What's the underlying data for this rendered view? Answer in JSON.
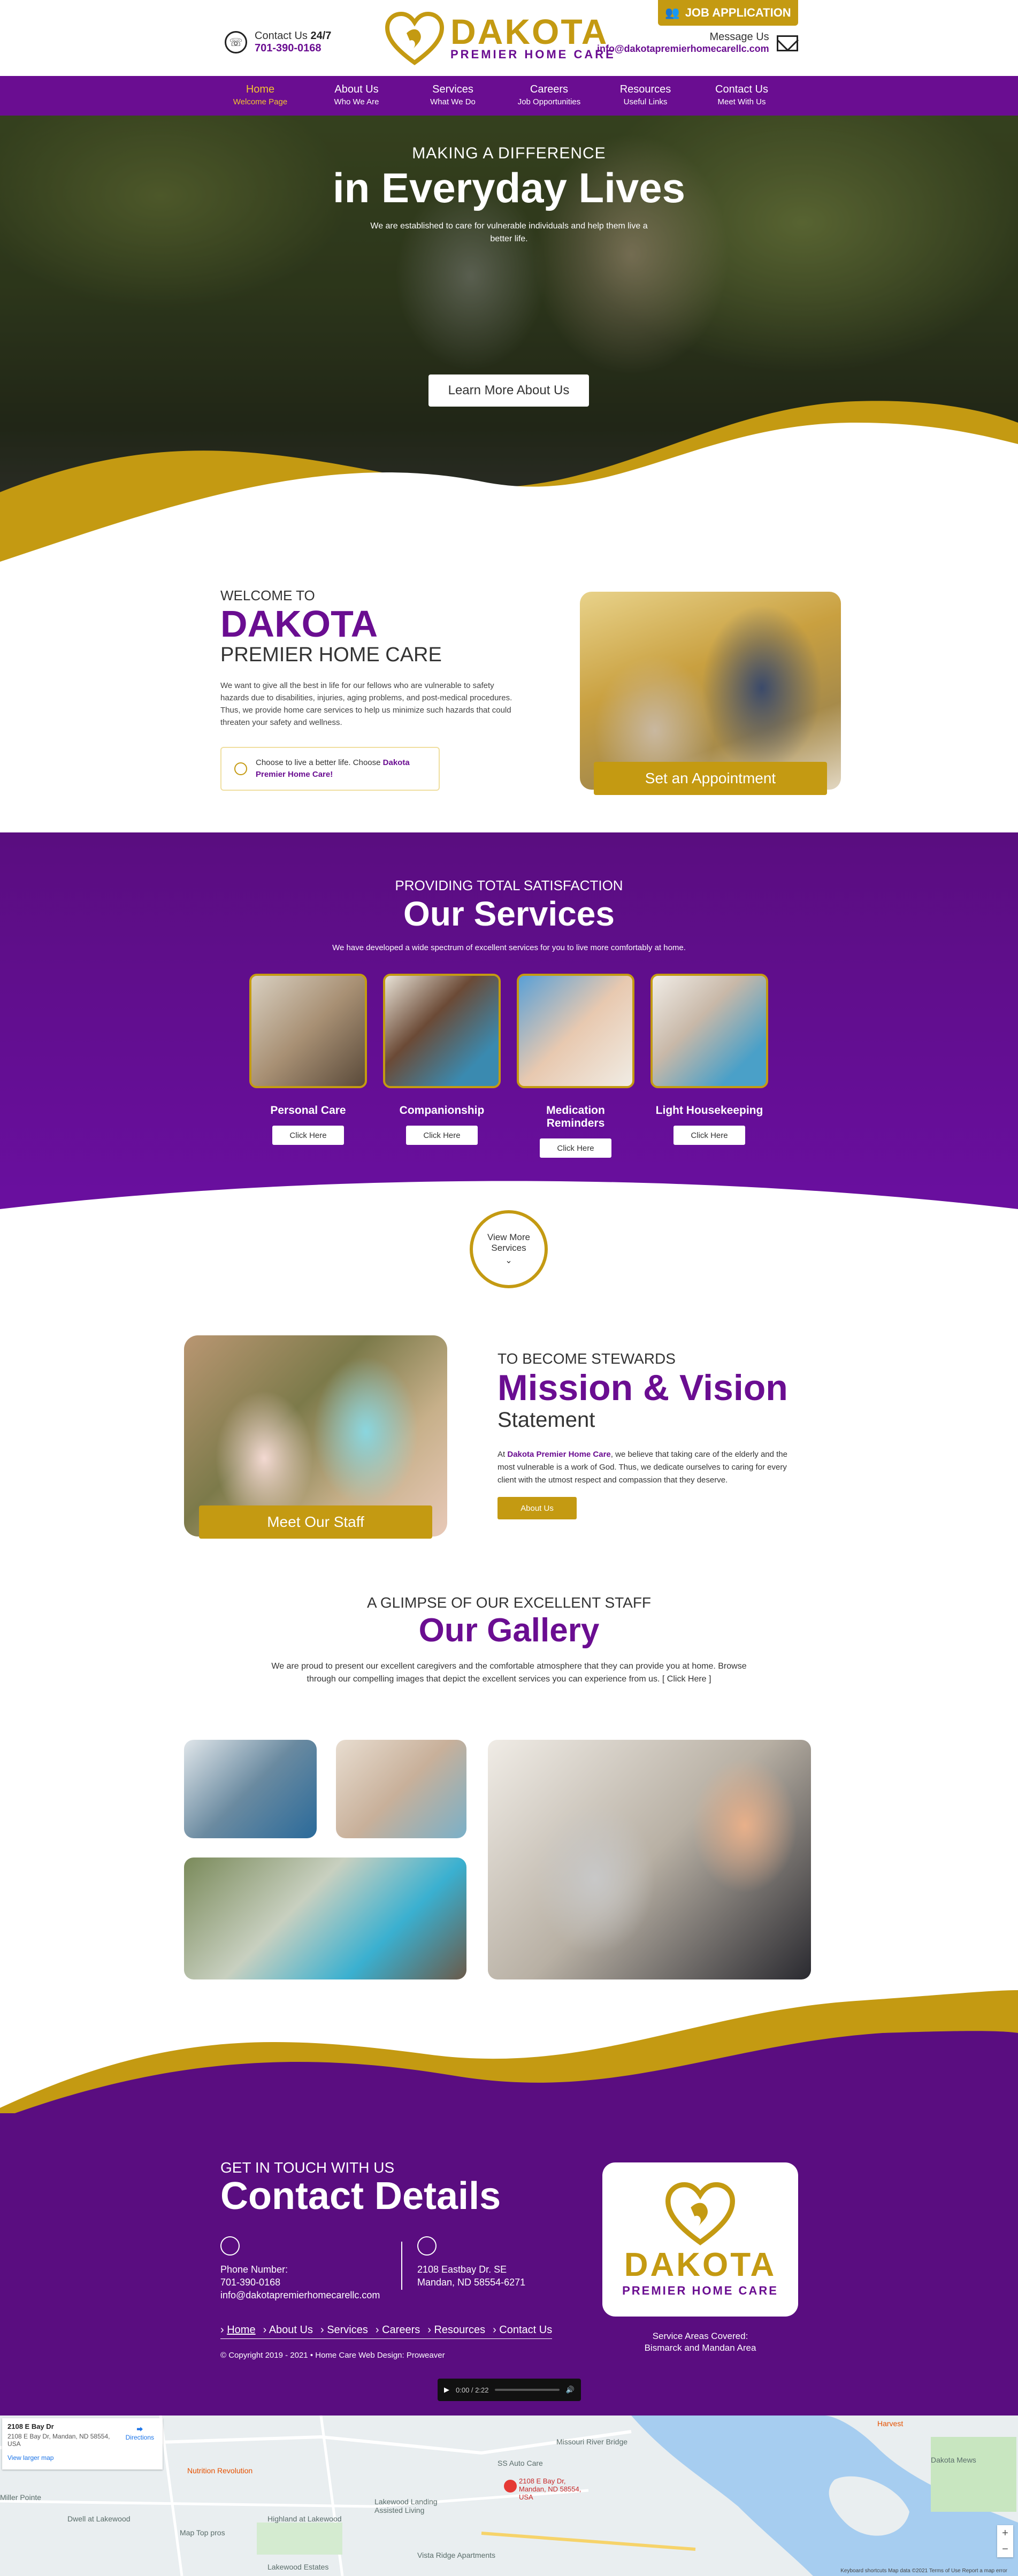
{
  "header": {
    "contact_label": "Contact Us",
    "contact_hours": "24/7",
    "phone": "701-390-0168",
    "logo_name": "DAKOTA",
    "logo_sub": "PREMIER HOME CARE",
    "job_button": "JOB APPLICATION",
    "message_label": "Message Us",
    "email": "info@dakotapremierhomecarellc.com"
  },
  "nav": [
    {
      "main": "Home",
      "sub": "Welcome Page"
    },
    {
      "main": "About Us",
      "sub": "Who We Are"
    },
    {
      "main": "Services",
      "sub": "What We Do"
    },
    {
      "main": "Careers",
      "sub": "Job Opportunities"
    },
    {
      "main": "Resources",
      "sub": "Useful Links"
    },
    {
      "main": "Contact Us",
      "sub": "Meet With Us"
    }
  ],
  "hero": {
    "kicker": "MAKING A DIFFERENCE",
    "headline": "in Everyday Lives",
    "text": "We are established to care for vulnerable individuals and help them live a better life.",
    "button": "Learn More About Us"
  },
  "welcome": {
    "kicker": "WELCOME TO",
    "title": "DAKOTA",
    "subtitle": "PREMIER HOME CARE",
    "text": "We want to give all the best in life for our fellows who are vulnerable to safety hazards due to disabilities, injuries, aging problems, and post-medical procedures. Thus, we provide home care services to help us minimize such hazards that could threaten your safety and wellness.",
    "choose_prefix": "Choose to live a better life. Choose",
    "choose_brand": "Dakota Premier Home Care!",
    "appointment_button": "Set an Appointment"
  },
  "services": {
    "kicker": "PROVIDING TOTAL SATISFACTION",
    "title": "Our Services",
    "text": "We have developed a wide spectrum of excellent services for you to live more comfortably at home.",
    "items": [
      {
        "title": "Personal Care",
        "button": "Click Here"
      },
      {
        "title": "Companionship",
        "button": "Click Here"
      },
      {
        "title": "Medication Reminders",
        "button": "Click Here"
      },
      {
        "title": "Light Housekeeping",
        "button": "Click Here"
      }
    ],
    "view_more_1": "View More",
    "view_more_2": "Services"
  },
  "mission": {
    "staff_button": "Meet Our Staff",
    "kicker": "TO BECOME STEWARDS",
    "title": "Mission & Vision",
    "subtitle": "Statement",
    "text_prefix": "At",
    "text_brand": "Dakota Premier Home Care",
    "text_rest": ", we believe that taking care of the elderly and the most vulnerable is a work of God. Thus, we dedicate ourselves to caring for every client with the utmost respect and compassion that they deserve.",
    "button": "About Us"
  },
  "gallery": {
    "kicker": "A GLIMPSE OF OUR EXCELLENT STAFF",
    "title": "Our Gallery",
    "text": "We are proud to present our excellent caregivers and the comfortable atmosphere that they can provide you at home. Browse through our compelling images that depict the excellent services you can experience from us. [ Click Here ]"
  },
  "contact": {
    "kicker": "GET IN TOUCH WITH US",
    "title": "Contact Details",
    "phone_label": "Phone Number:",
    "phone": "701-390-0168",
    "email": "info@dakotapremierhomecarellc.com",
    "address_1": "2108 Eastbay Dr. SE",
    "address_2": "Mandan, ND 58554-6271",
    "links": [
      "Home",
      "About Us",
      "Services",
      "Careers",
      "Resources",
      "Contact Us"
    ],
    "copyright": "© Copyright 2019 - 2021 • Home Care Web Design: Proweaver",
    "logo_name": "DAKOTA",
    "logo_sub": "PREMIER HOME CARE",
    "areas_label": "Service Areas Covered:",
    "areas": "Bismarck and Mandan Area",
    "audio_time": "0:00 / 2:22"
  },
  "map": {
    "card_title": "2108 E Bay Dr",
    "card_address": "2108 E Bay Dr, Mandan, ND 58554, USA",
    "larger_map": "View larger map",
    "directions": "Directions",
    "pin_label": "2108 E Bay Dr, Mandan, ND 58554, USA",
    "places": [
      "Missouri River Bridge",
      "SS Auto Care",
      "Lakewood Landing Assisted Living",
      "Highland at Lakewood",
      "Map Top pros",
      "Dwell at Lakewood",
      "Miller Pointe",
      "Dakota Mews",
      "Harvest",
      "Nutrition Revolution",
      "Lakewood Estates",
      "Vista Ridge Apartments"
    ],
    "footer": "Keyboard shortcuts   Map data ©2021   Terms of Use   Report a map error"
  },
  "colors": {
    "purple": "#6a0d91",
    "gold": "#c49a12",
    "dark_purple": "#5a0d80"
  }
}
